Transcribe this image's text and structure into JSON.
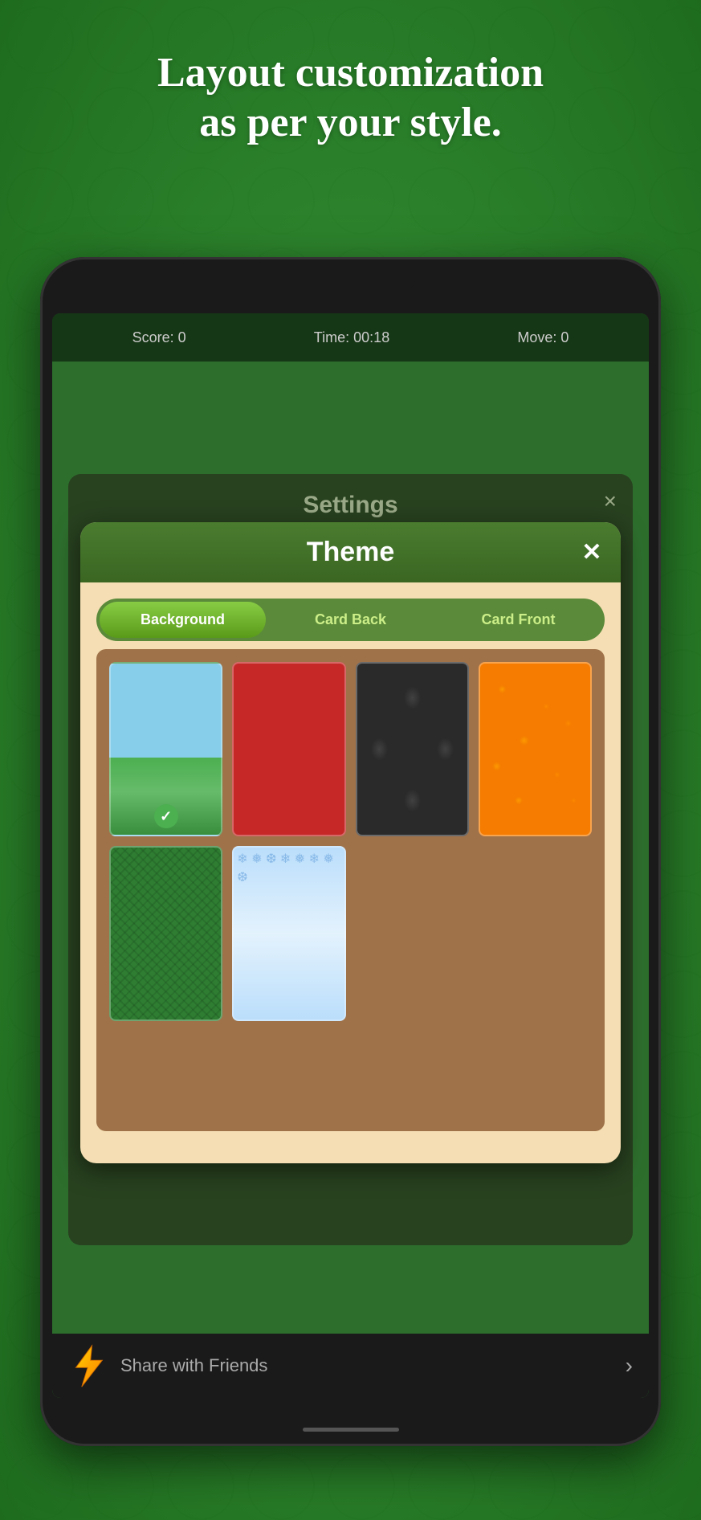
{
  "headline": {
    "line1": "Layout customization",
    "line2": "as per your style."
  },
  "phone": {
    "statusbar": {
      "score_label": "Score:",
      "score_value": "0",
      "time_label": "Time:",
      "time_value": "00:18",
      "move_label": "Move:",
      "move_value": "0"
    }
  },
  "settings": {
    "title": "Settings",
    "close_label": "×"
  },
  "theme_dialog": {
    "title": "Theme",
    "close_label": "✕",
    "tabs": [
      {
        "id": "background",
        "label": "Background",
        "active": true
      },
      {
        "id": "card_back",
        "label": "Card Back",
        "active": false
      },
      {
        "id": "card_front",
        "label": "Card Front",
        "active": false
      }
    ],
    "cards": [
      {
        "id": "sky",
        "type": "sky",
        "selected": true
      },
      {
        "id": "red",
        "type": "red",
        "selected": false
      },
      {
        "id": "dark",
        "type": "dark",
        "selected": false
      },
      {
        "id": "orange",
        "type": "orange",
        "selected": false
      },
      {
        "id": "green",
        "type": "green",
        "selected": false
      },
      {
        "id": "snow",
        "type": "snow",
        "selected": false
      }
    ]
  },
  "share_bar": {
    "text": "Share with Friends",
    "arrow": "›"
  }
}
